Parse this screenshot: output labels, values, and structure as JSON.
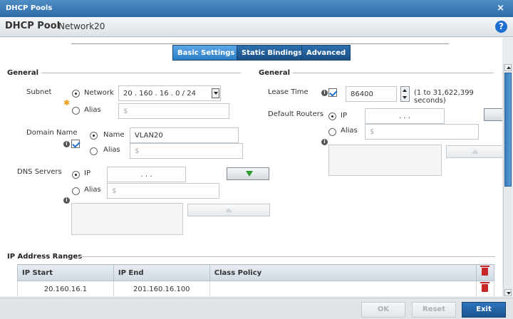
{
  "window": {
    "title": "DHCP Pools",
    "close_label": "×"
  },
  "header": {
    "title": "DHCP Pool",
    "pool_name": "Network20",
    "help_label": "?"
  },
  "tabs": [
    {
      "label": "Basic Settings",
      "active": true
    },
    {
      "label": "Static Bindings",
      "active": false
    },
    {
      "label": "Advanced",
      "active": false
    }
  ],
  "left_general": {
    "section_title": "General",
    "subnet_label": "Subnet",
    "subnet_network_label": "Network",
    "subnet_value": "20 . 160 . 16 . 0 / 24",
    "subnet_alias_label": "Alias",
    "subnet_alias_placeholder": "$",
    "domain_name_label": "Domain Name",
    "domain_name_option_label": "Name",
    "domain_name_value": "VLAN20",
    "domain_alias_label": "Alias",
    "domain_alias_placeholder": "$",
    "dns_label": "DNS Servers",
    "dns_ip_label": "IP",
    "dns_ip_value": ". . .",
    "dns_alias_label": "Alias",
    "dns_alias_placeholder": "$"
  },
  "right_general": {
    "section_title": "General",
    "lease_label": "Lease Time",
    "lease_value": "86400",
    "lease_hint": "(1 to 31,622,399 seconds)",
    "routers_label": "Default Routers",
    "routers_ip_label": "IP",
    "routers_ip_value": ". . .",
    "routers_alias_label": "Alias",
    "routers_alias_placeholder": "$"
  },
  "ip_ranges": {
    "section_title": "IP Address Ranges",
    "columns": [
      "IP Start",
      "IP End",
      "Class Policy"
    ],
    "rows": [
      {
        "start": "20.160.16.1",
        "end": "201.160.16.100",
        "policy": ""
      }
    ]
  },
  "footer": {
    "ok_label": "OK",
    "reset_label": "Reset",
    "exit_label": "Exit"
  },
  "colors": {
    "titlebar": "#2f6aa6",
    "tab_active": "#3f8fd4",
    "delete": "#c62828",
    "add_arrow": "#2d9a2f"
  }
}
